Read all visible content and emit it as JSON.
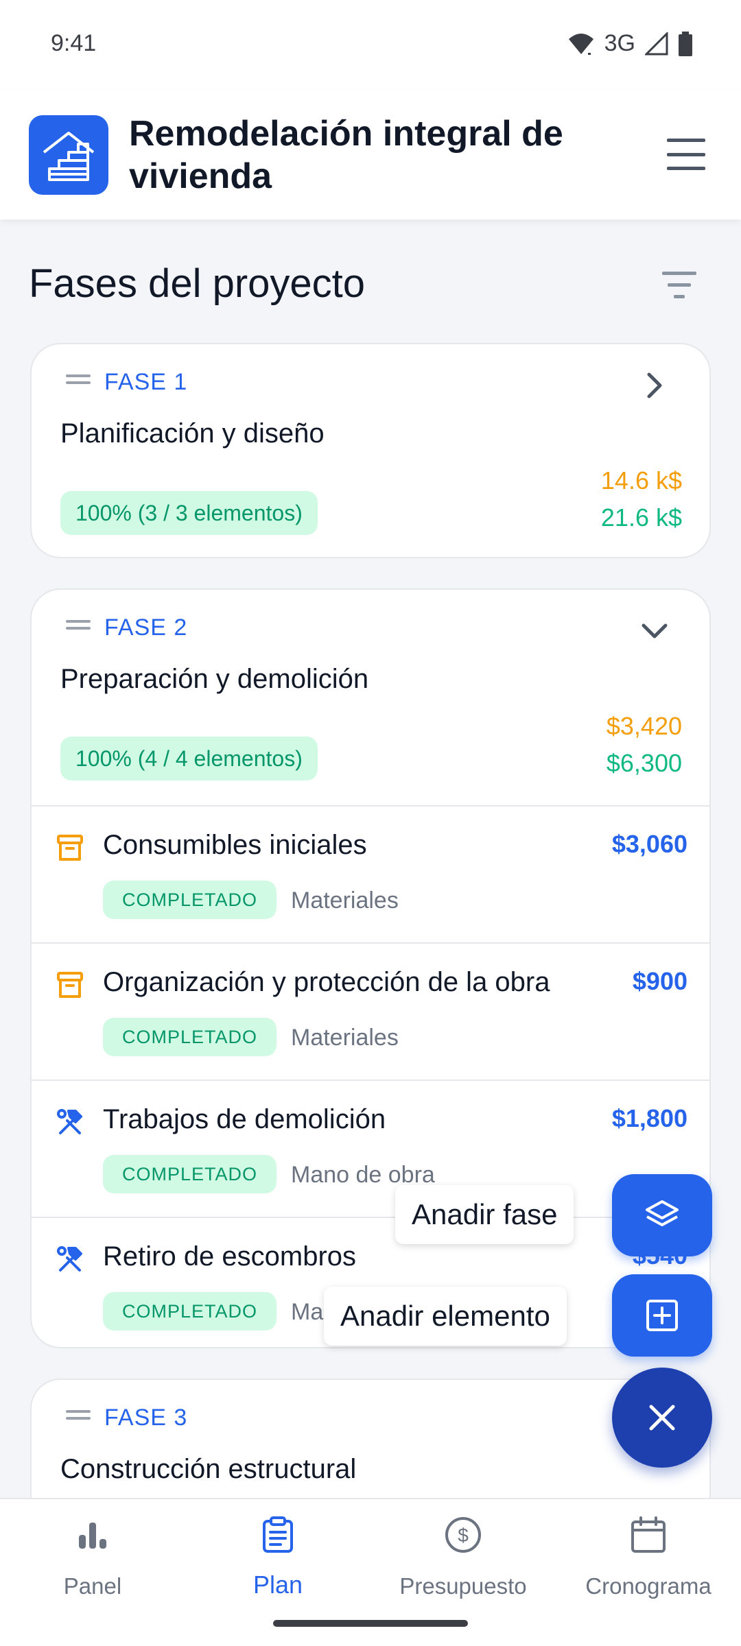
{
  "status_bar": {
    "time": "9:41",
    "network": "3G"
  },
  "app": {
    "title": "Remodelación integral de vivienda"
  },
  "section": {
    "title": "Fases del proyecto"
  },
  "phases": [
    {
      "label": "FASE 1",
      "name": "Planificación y diseño",
      "progress": "100% (3 / 3 elementos)",
      "cost_estimated": "14.6 k$",
      "cost_real": "21.6 k$",
      "expanded": false
    },
    {
      "label": "FASE 2",
      "name": "Preparación y demolición",
      "progress": "100% (4 / 4 elementos)",
      "cost_estimated": "$3,420",
      "cost_real": "$6,300",
      "expanded": true,
      "items": [
        {
          "name": "Consumibles iniciales",
          "price": "$3,060",
          "status": "COMPLETADO",
          "category": "Materiales",
          "icon": "archive-box-icon"
        },
        {
          "name": "Organización y protección de la obra",
          "price": "$900",
          "status": "COMPLETADO",
          "category": "Materiales",
          "icon": "archive-box-icon"
        },
        {
          "name": "Trabajos de demolición",
          "price": "$1,800",
          "status": "COMPLETADO",
          "category": "Mano de obra",
          "icon": "hammer-wrench-icon"
        },
        {
          "name": "Retiro de escombros",
          "price": "$540",
          "status": "COMPLETADO",
          "category": "Mano de obra",
          "icon": "hammer-wrench-icon"
        }
      ]
    },
    {
      "label": "FASE 3",
      "name": "Construcción estructural"
    }
  ],
  "fab": {
    "add_phase": "Anadir fase",
    "add_item": "Anadir elemento"
  },
  "bottom_nav": [
    {
      "label": "Panel",
      "icon": "bar-chart-icon",
      "active": false
    },
    {
      "label": "Plan",
      "icon": "clipboard-list-icon",
      "active": true
    },
    {
      "label": "Presupuesto",
      "icon": "dollar-circle-icon",
      "active": false
    },
    {
      "label": "Cronograma",
      "icon": "calendar-icon",
      "active": false
    }
  ],
  "colors": {
    "primary": "#2563eb",
    "primary_dark": "#1e40af",
    "success": "#10b981",
    "success_bg": "#d1fae5",
    "warning": "#f59e0b"
  }
}
